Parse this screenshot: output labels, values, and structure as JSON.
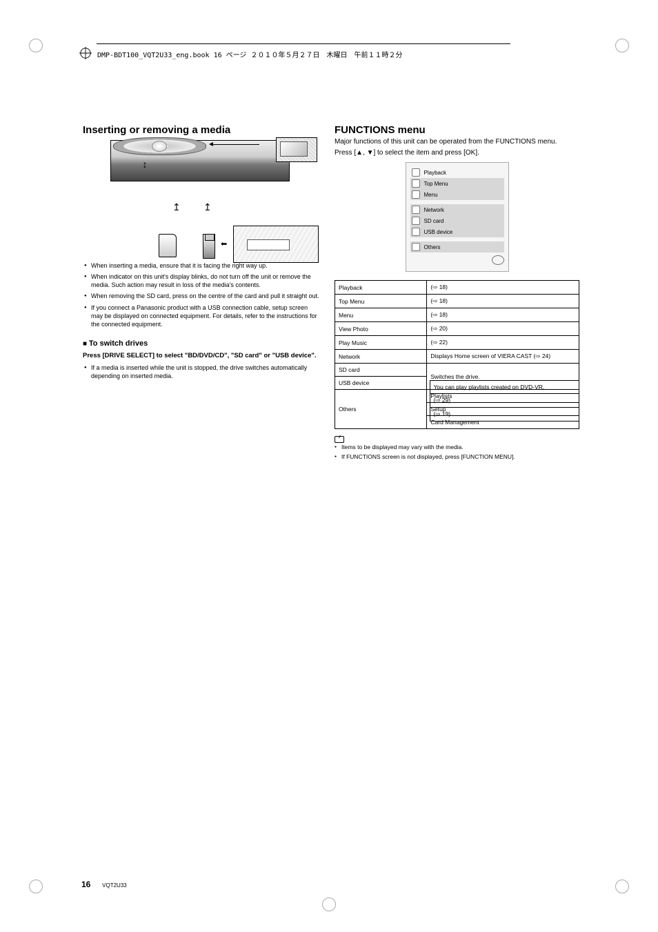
{
  "file_header": "DMP-BDT100_VQT2U33_eng.book  16 ページ  ２０１０年５月２７日　木曜日　午前１１時２分",
  "left": {
    "title": "Inserting or removing a media",
    "bullets": [
      "When inserting a media, ensure that it is facing the right way up.",
      "When indicator on this unit's display blinks, do not turn off the unit or remove the media. Such action may result in loss of the media's contents.",
      "When removing the SD card, press on the centre of the card and pull it straight out.",
      "If you connect a Panasonic product with a USB connection cable, setup screen may be displayed on connected equipment. For details, refer to the instructions for the connected equipment."
    ],
    "sub_heading": "To switch drives",
    "sub_bold": "Press [DRIVE SELECT] to select \"BD/DVD/CD\", \"SD card\" or \"USB device\".",
    "sub_bullet": "If a media is inserted while the unit is stopped, the drive switches automatically depending on inserted media."
  },
  "right": {
    "title": "FUNCTIONS menu",
    "desc_pre": "Major functions of this unit can be operated from the FUNCTIONS menu.",
    "desc_line": "Press [▲, ▼] to select the item and press [OK].",
    "menu": {
      "items": [
        "Playback",
        "Top Menu",
        "Menu"
      ],
      "special": [
        "Network",
        "SD card",
        "USB device"
      ],
      "last": "Others"
    },
    "table": [
      {
        "left": "Playback",
        "right": "(⇨ 18)"
      },
      {
        "left": "Top Menu",
        "right": "(⇨ 18)"
      },
      {
        "left": "Menu",
        "right": "(⇨ 18)"
      },
      {
        "left": "View Photo",
        "right": "(⇨ 20)"
      },
      {
        "left": "Play Music",
        "right": "(⇨ 22)"
      },
      {
        "left": "Network",
        "right": "Displays Home screen of VIERA CAST (⇨ 24)"
      },
      {
        "left": "SD card",
        "right_span": "Switches the drive.",
        "rowspan": 2
      },
      {
        "left": "USB device"
      }
    ],
    "others_group": {
      "header": "Others",
      "rows": [
        {
          "left": "Playlists",
          "right": "You can play playlists created on DVD-VR."
        },
        {
          "left": "Setup",
          "right": "(⇨ 29)"
        },
        {
          "left": "Card Management",
          "right": "(⇨ 19)"
        }
      ]
    },
    "notice_line1": "Items to be displayed may vary with the media.",
    "notice_line2": "If FUNCTIONS screen is not displayed, press [FUNCTION MENU]."
  },
  "page_number": "16",
  "doc_code": "VQT2U33"
}
